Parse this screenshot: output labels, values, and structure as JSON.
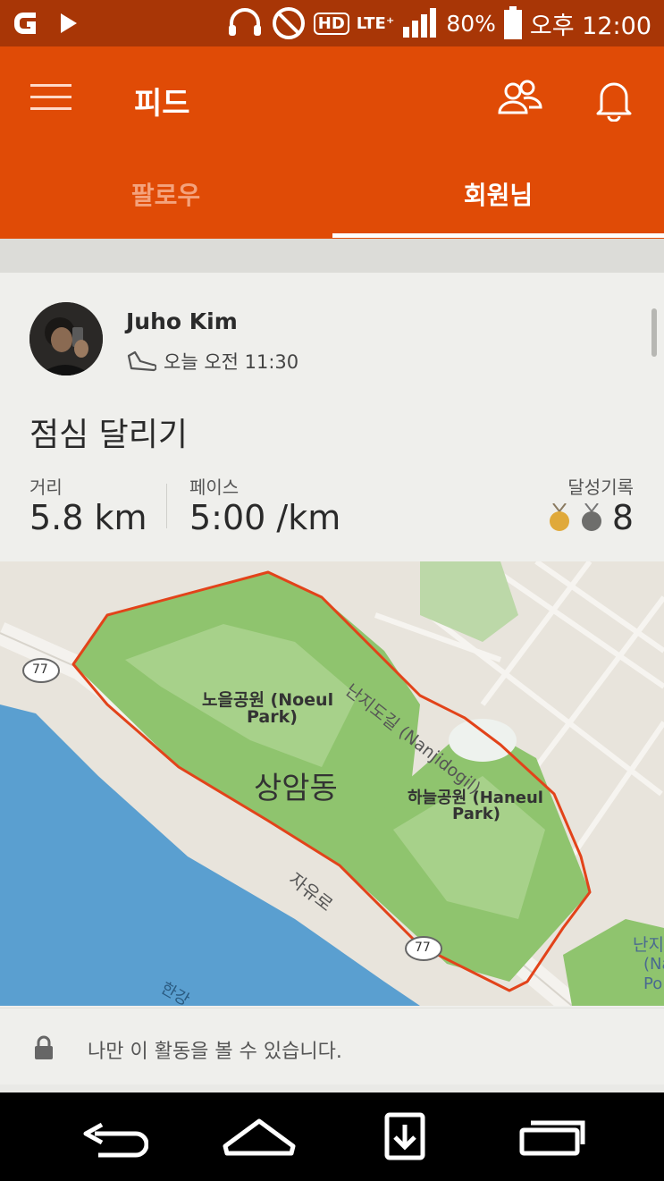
{
  "status_bar": {
    "hd": "HD",
    "lte": "LTE⁺",
    "battery": "80%",
    "time": "오후 12:00"
  },
  "toolbar": {
    "title": "피드"
  },
  "tabs": [
    {
      "label": "팔로우"
    },
    {
      "label": "회원님"
    }
  ],
  "post": {
    "athlete": "Juho Kim",
    "time": "오늘 오전 11:30",
    "title": "점심 달리기",
    "stats": {
      "distance_label": "거리",
      "distance_value": "5.8 km",
      "pace_label": "페이스",
      "pace_value": "5:00 /km",
      "achievements_label": "달성기록",
      "achievements_count": "8"
    },
    "map": {
      "labels": {
        "noeul": "노을공원 (Noeul",
        "noeul2": "Park)",
        "sangam": "상암동",
        "haneul": "하늘공원 (Haneul",
        "haneul2": "Park)",
        "nanjido": "난지도길 (Nanjidogil)",
        "jayuro": "자유로",
        "route77a": "77",
        "route77b": "77",
        "edge1": "난지",
        "edge2": "(Na",
        "edge3": "Po",
        "river": "한강"
      }
    },
    "privacy": "나만 이 활동을 볼 수 있습니다."
  }
}
